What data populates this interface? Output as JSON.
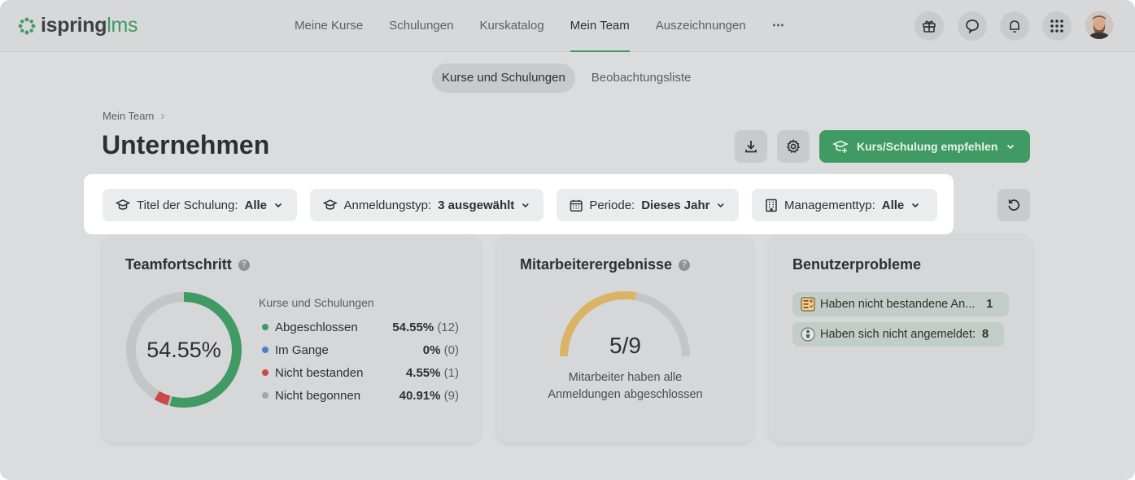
{
  "logo": {
    "part1": "ispring",
    "part2": "lms"
  },
  "nav": {
    "items": [
      "Meine Kurse",
      "Schulungen",
      "Kurskatalog",
      "Mein Team",
      "Auszeichnungen"
    ],
    "active": "Mein Team",
    "more": "⋯"
  },
  "colors": {
    "accent": "#3f9a63",
    "completed": "#3f9a63",
    "in_progress": "#4a7fc8",
    "failed": "#c94a44",
    "not_started": "#a4a6a8",
    "gauge": "#d9b465"
  },
  "subtabs": [
    "Kurse und Schulungen",
    "Beobachtungsliste"
  ],
  "breadcrumb": {
    "item": "Mein Team",
    "sep": "›"
  },
  "page_title": "Unternehmen",
  "actions": {
    "recommend_label": "Kurs/Schulung empfehlen"
  },
  "filters": [
    {
      "label": "Titel der Schulung:",
      "value": "Alle",
      "icon": "graduation-cap-icon"
    },
    {
      "label": "Anmeldungstyp:",
      "value": "3 ausgewählt",
      "icon": "graduation-cap-icon"
    },
    {
      "label": "Periode:",
      "value": "Dieses Jahr",
      "icon": "calendar-icon"
    },
    {
      "label": "Managementtyp:",
      "value": "Alle",
      "icon": "building-icon"
    }
  ],
  "team_progress": {
    "title": "Teamfortschritt",
    "center_label": "54.55%",
    "legend_head": "Kurse und Schulungen",
    "rows": [
      {
        "label": "Abgeschlossen",
        "percent": "54.55%",
        "count": "(12)",
        "value": 54.55,
        "color": "#3f9a63"
      },
      {
        "label": "Im Gange",
        "percent": "0%",
        "count": "(0)",
        "value": 0,
        "color": "#4a7fc8"
      },
      {
        "label": "Nicht bestanden",
        "percent": "4.55%",
        "count": "(1)",
        "value": 4.55,
        "color": "#c94a44"
      },
      {
        "label": "Nicht begonnen",
        "percent": "40.91%",
        "count": "(9)",
        "value": 40.91,
        "color": "#c3c5c7"
      }
    ]
  },
  "employee_results": {
    "title": "Mitarbeiterergebnisse",
    "value_label": "5/9",
    "completed": 5,
    "total": 9,
    "caption_line1": "Mitarbeiter haben alle",
    "caption_line2": "Anmeldungen abgeschlossen"
  },
  "user_problems": {
    "title": "Benutzerprobleme",
    "items": [
      {
        "label": "Haben nicht bestandene An...",
        "count": "1",
        "icon": "failed-test-icon"
      },
      {
        "label": "Haben sich nicht angemeldet:",
        "count": "8",
        "icon": "inactive-user-icon"
      }
    ]
  }
}
